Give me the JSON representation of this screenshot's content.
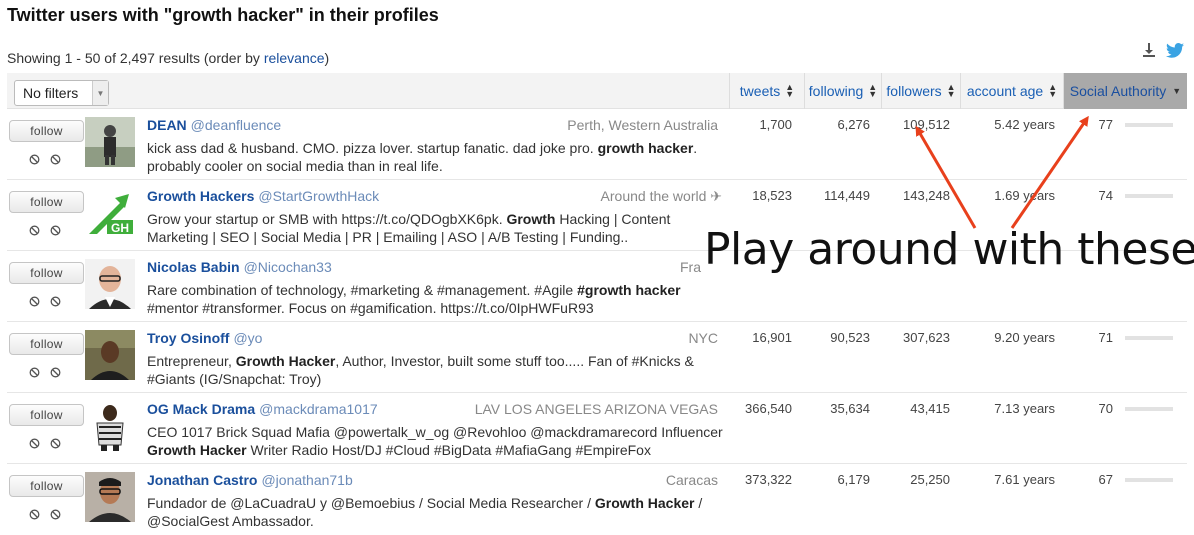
{
  "page": {
    "title": "Twitter users with \"growth hacker\" in their profiles",
    "summary_prefix": "Showing 1 - 50 of 2,497 results (order by ",
    "summary_link": "relevance",
    "summary_suffix": ")"
  },
  "toolbar": {
    "filter_value": "No filters",
    "columns": [
      {
        "label": "tweets",
        "active": false
      },
      {
        "label": "following",
        "active": false
      },
      {
        "label": "followers",
        "active": false
      },
      {
        "label": "account age",
        "active": false
      },
      {
        "label": "Social Authority",
        "active": true
      }
    ],
    "icons": [
      "download-icon",
      "twitter-bird-icon"
    ]
  },
  "follow_label": "follow",
  "rows": [
    {
      "name": "DEAN",
      "handle": "@deanfluence",
      "location": "Perth, Western Australia",
      "bio_html": "kick ass dad &amp; husband. CMO. pizza lover. startup fanatic. dad joke pro. <b>growth hacker</b>. probably cooler on social media than in real life.",
      "tweets": "1,700",
      "following": "6,276",
      "followers": "109,512",
      "age": "5.42 years",
      "authority": "77"
    },
    {
      "name": "Growth Hackers",
      "handle": "@StartGrowthHack",
      "location": "Around the world ✈",
      "bio_html": "Grow your startup or SMB with https://t.co/QDOgbXK6pk. <b>Growth</b> Hacking | Content Marketing | SEO | Social Media | PR | Emailing | ASO | A/B Testing | Funding..",
      "tweets": "18,523",
      "following": "114,449",
      "followers": "143,248",
      "age": "1.69 years",
      "authority": "74"
    },
    {
      "name": "Nicolas Babin",
      "handle": "@Nicochan33",
      "location": "Fra",
      "bio_html": "Rare combination of technology, #marketing &amp; #management. #Agile <b>#growth hacker</b> #mentor #transformer. Focus on #gamification. https://t.co/0IpHWFuR93",
      "tweets": "",
      "following": "",
      "followers": "",
      "age": "",
      "authority": ""
    },
    {
      "name": "Troy Osinoff",
      "handle": "@yo",
      "location": "NYC",
      "bio_html": "Entrepreneur, <b>Growth Hacker</b>, Author, Investor, built some stuff too..... Fan of #Knicks &amp; #Giants (IG/Snapchat: Troy)",
      "tweets": "16,901",
      "following": "90,523",
      "followers": "307,623",
      "age": "9.20 years",
      "authority": "71"
    },
    {
      "name": "OG Mack Drama",
      "handle": "@mackdrama1017",
      "location": "LAV LOS ANGELES ARIZONA VEGAS",
      "bio_html": "CEO 1017 Brick Squad Mafia @powertalk_w_og @Revohloo @mackdramarecord Influencer <b>Growth Hacker</b> Writer Radio Host/DJ #Cloud #BigData #MafiaGang #EmpireFox",
      "tweets": "366,540",
      "following": "35,634",
      "followers": "43,415",
      "age": "7.13 years",
      "authority": "70"
    },
    {
      "name": "Jonathan Castro",
      "handle": "@jonathan71b",
      "location": "Caracas",
      "bio_html": "Fundador de @LaCuadraU y @Bemoebius / Social Media Researcher / <b>Growth Hacker</b> / @SocialGest Ambassador.",
      "tweets": "373,322",
      "following": "6,179",
      "followers": "25,250",
      "age": "7.61 years",
      "authority": "67"
    }
  ],
  "annotation": "Play around with these",
  "colors": {
    "link": "#1a4f9c",
    "active_header": "#a9a9a9",
    "arrow": "#e8401c"
  }
}
